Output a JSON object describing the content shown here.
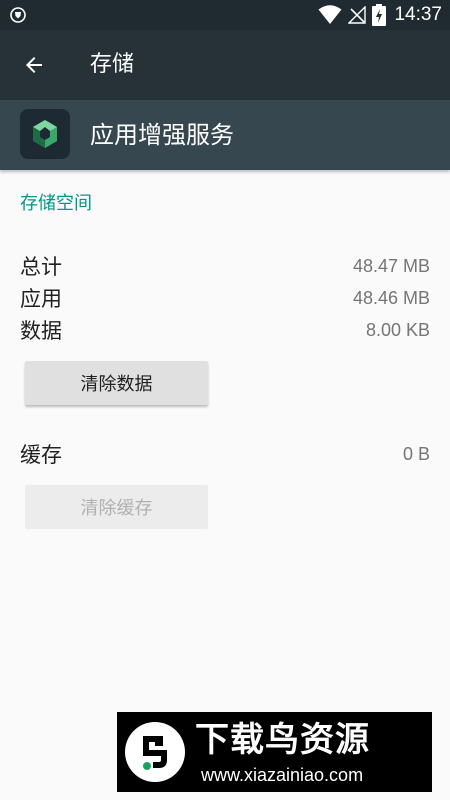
{
  "status_bar": {
    "time": "14:37",
    "icons": [
      "vpn-shield-icon",
      "wifi-icon",
      "no-signal-icon",
      "battery-charging-icon"
    ]
  },
  "toolbar": {
    "title": "存储",
    "back_icon": "arrow-back-icon"
  },
  "app": {
    "name": "应用增强服务",
    "icon": "app-cube-icon"
  },
  "storage": {
    "section_title": "存储空间",
    "rows": [
      {
        "label": "总计",
        "value": "48.47 MB"
      },
      {
        "label": "应用",
        "value": "48.46 MB"
      },
      {
        "label": "数据",
        "value": "8.00 KB"
      }
    ],
    "clear_data_label": "清除数据"
  },
  "cache": {
    "label": "缓存",
    "value": "0 B",
    "clear_cache_label": "清除缓存"
  },
  "watermark": {
    "title": "下载鸟资源",
    "url": "www.xiazainiao.com"
  },
  "colors": {
    "status_bar": "#1f2b30",
    "toolbar": "#263238",
    "app_header": "#37474f",
    "accent": "#009688"
  }
}
